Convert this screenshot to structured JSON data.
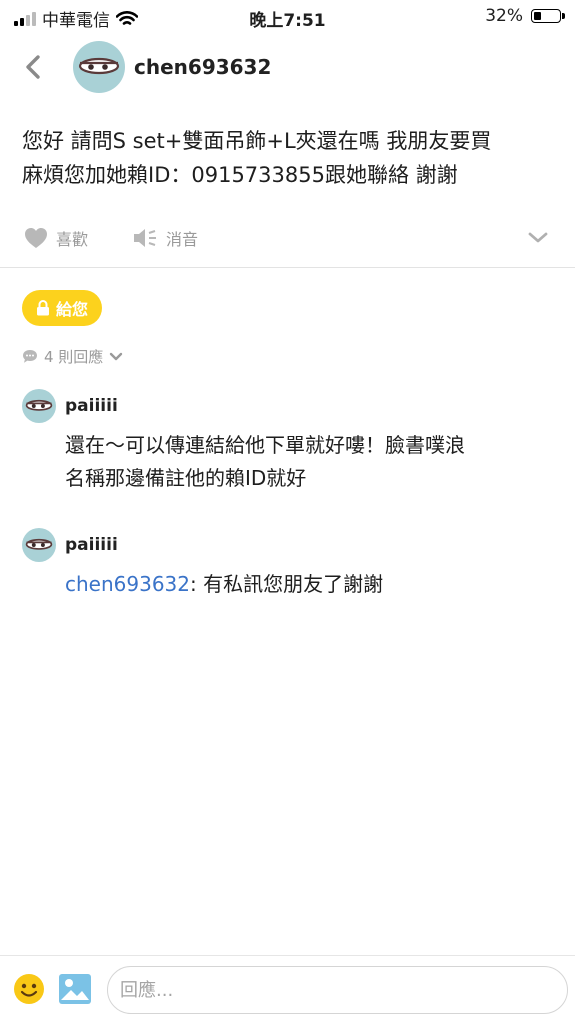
{
  "status_bar": {
    "carrier": "中華電信",
    "time": "晚上7:51",
    "battery": "32%",
    "battery_level": 0.32
  },
  "header": {
    "username": "chen693632"
  },
  "post": {
    "lines": [
      "您好 請問S set+雙面吊飾+L夾還在嗎 我朋友要買",
      "麻煩您加她賴ID：0915733855跟她聯絡 謝謝"
    ]
  },
  "actions": {
    "like": "喜歡",
    "mute": "消音"
  },
  "gift_badge": "給您",
  "reply_count": "4 則回應",
  "comments": [
    {
      "name": "paiiiii",
      "lines": [
        "還在～可以傳連結給他下單就好嘍！臉書噗浪",
        "名稱那邊備註他的賴ID就好"
      ]
    },
    {
      "name": "paiiiii",
      "mention": "chen693632",
      "text": ": 有私訊您朋友了謝謝"
    }
  ],
  "reply_input": {
    "placeholder": "回應..."
  },
  "colors": {
    "accent": "#fcd21d",
    "link": "#3a73c8",
    "avatar_bg": "#a9d1d6"
  }
}
